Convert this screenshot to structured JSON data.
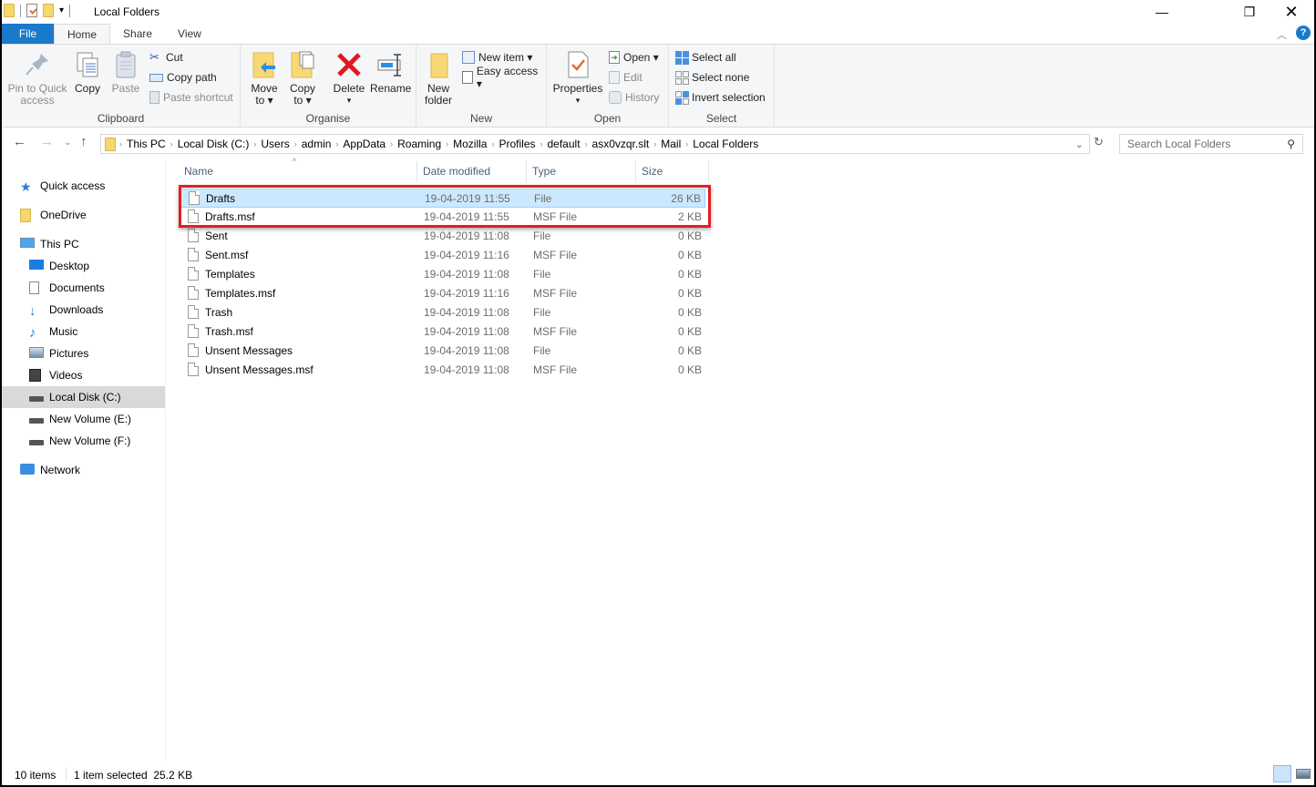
{
  "window": {
    "title": "Local Folders"
  },
  "tabs": [
    {
      "label": "File"
    },
    {
      "label": "Home"
    },
    {
      "label": "Share"
    },
    {
      "label": "View"
    }
  ],
  "ribbon": {
    "clipboard": {
      "label": "Clipboard",
      "pin": "Pin to Quick access",
      "pin1": "Pin to Quick",
      "pin2": "access",
      "copy": "Copy",
      "paste": "Paste",
      "cut": "Cut",
      "copy_path": "Copy path",
      "paste_shortcut": "Paste shortcut"
    },
    "organise": {
      "label": "Organise",
      "move1": "Move",
      "move2": "to ▾",
      "copy1": "Copy",
      "copy2": "to ▾",
      "delete": "Delete",
      "delete_arrow": "▾",
      "rename": "Rename"
    },
    "new": {
      "label": "New",
      "new_folder1": "New",
      "new_folder2": "folder",
      "new_item": "New item ▾",
      "easy_access": "Easy access ▾"
    },
    "open": {
      "label": "Open",
      "properties": "Properties",
      "properties_arrow": "▾",
      "open": "Open ▾",
      "edit": "Edit",
      "history": "History"
    },
    "select": {
      "label": "Select",
      "select_all": "Select all",
      "select_none": "Select none",
      "invert": "Invert selection"
    }
  },
  "address": {
    "crumbs": [
      "This PC",
      "Local Disk (C:)",
      "Users",
      "admin",
      "AppData",
      "Roaming",
      "Mozilla",
      "Profiles",
      "default",
      "asx0vzqr.slt",
      "Mail",
      "Local Folders"
    ]
  },
  "search": {
    "placeholder": "Search Local Folders"
  },
  "sidebar": {
    "items": [
      {
        "label": "Quick access",
        "icon": "star-icon"
      },
      {
        "label": "OneDrive",
        "icon": "folder-icon"
      },
      {
        "label": "This PC",
        "icon": "computer-icon"
      },
      {
        "label": "Desktop",
        "icon": "desktop-icon"
      },
      {
        "label": "Documents",
        "icon": "documents-icon"
      },
      {
        "label": "Downloads",
        "icon": "download-icon"
      },
      {
        "label": "Music",
        "icon": "music-icon"
      },
      {
        "label": "Pictures",
        "icon": "pictures-icon"
      },
      {
        "label": "Videos",
        "icon": "videos-icon"
      },
      {
        "label": "Local Disk (C:)",
        "icon": "drive-icon"
      },
      {
        "label": "New Volume (E:)",
        "icon": "drive-icon"
      },
      {
        "label": "New Volume (F:)",
        "icon": "drive-icon"
      },
      {
        "label": "Network",
        "icon": "network-icon"
      }
    ]
  },
  "columns": {
    "name": "Name",
    "date": "Date modified",
    "type": "Type",
    "size": "Size"
  },
  "files": [
    {
      "name": "Drafts",
      "date": "19-04-2019 11:55",
      "type": "File",
      "size": "26 KB"
    },
    {
      "name": "Drafts.msf",
      "date": "19-04-2019 11:55",
      "type": "MSF File",
      "size": "2 KB"
    },
    {
      "name": "Sent",
      "date": "19-04-2019 11:08",
      "type": "File",
      "size": "0 KB"
    },
    {
      "name": "Sent.msf",
      "date": "19-04-2019 11:16",
      "type": "MSF File",
      "size": "0 KB"
    },
    {
      "name": "Templates",
      "date": "19-04-2019 11:08",
      "type": "File",
      "size": "0 KB"
    },
    {
      "name": "Templates.msf",
      "date": "19-04-2019 11:16",
      "type": "MSF File",
      "size": "0 KB"
    },
    {
      "name": "Trash",
      "date": "19-04-2019 11:08",
      "type": "File",
      "size": "0 KB"
    },
    {
      "name": "Trash.msf",
      "date": "19-04-2019 11:08",
      "type": "MSF File",
      "size": "0 KB"
    },
    {
      "name": "Unsent Messages",
      "date": "19-04-2019 11:08",
      "type": "File",
      "size": "0 KB"
    },
    {
      "name": "Unsent Messages.msf",
      "date": "19-04-2019 11:08",
      "type": "MSF File",
      "size": "0 KB"
    }
  ],
  "status": {
    "count": "10 items",
    "selected": "1 item selected  25.2 KB"
  }
}
